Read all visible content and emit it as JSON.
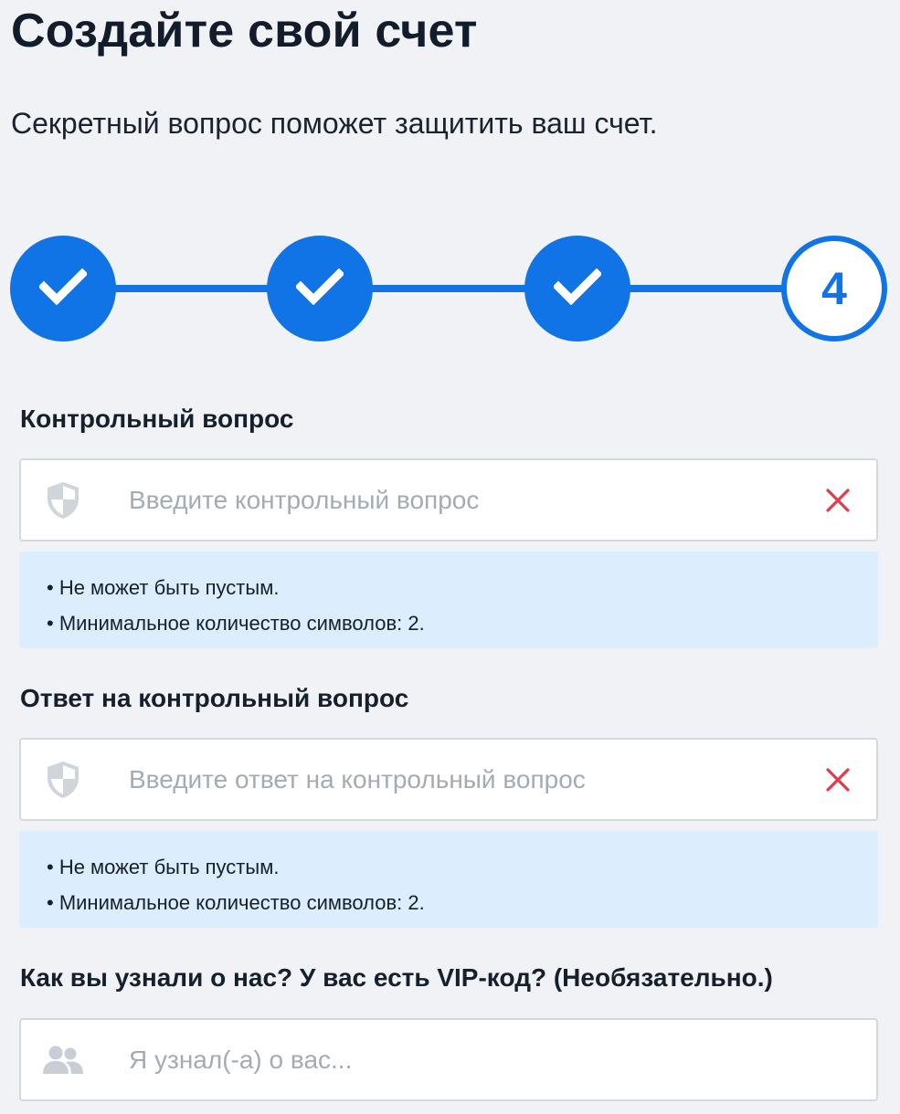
{
  "header": {
    "title": "Создайте свой счет",
    "subtitle": "Секретный вопрос поможет защитить ваш счет."
  },
  "stepper": {
    "steps": [
      {
        "state": "completed",
        "icon": "check-icon"
      },
      {
        "state": "completed",
        "icon": "check-icon"
      },
      {
        "state": "completed",
        "icon": "check-icon"
      },
      {
        "state": "current",
        "number": "4"
      }
    ]
  },
  "form": {
    "security_question": {
      "label": "Контрольный вопрос",
      "placeholder": "Введите контрольный вопрос",
      "value": "",
      "icon": "shield-icon",
      "status_icon": "error-x-icon",
      "hints": [
        "• Не может быть пустым.",
        "• Минимальное количество символов: 2."
      ]
    },
    "security_answer": {
      "label": "Ответ на контрольный вопрос",
      "placeholder": "Введите ответ на контрольный вопрос",
      "value": "",
      "icon": "shield-icon",
      "status_icon": "error-x-icon",
      "hints": [
        "• Не может быть пустым.",
        "• Минимальное количество символов: 2."
      ]
    },
    "referral": {
      "label": "Как вы узнали о нас? У вас есть VIP-код? (Необязательно.)",
      "placeholder": "Я узнал(-а) о вас...",
      "value": "",
      "icon": "users-icon"
    }
  },
  "colors": {
    "accent": "#1074e7",
    "background": "#f0f2f6",
    "error": "#e23b4a",
    "hint_background": "#dcedfd",
    "icon_gray": "#c9ced6"
  }
}
